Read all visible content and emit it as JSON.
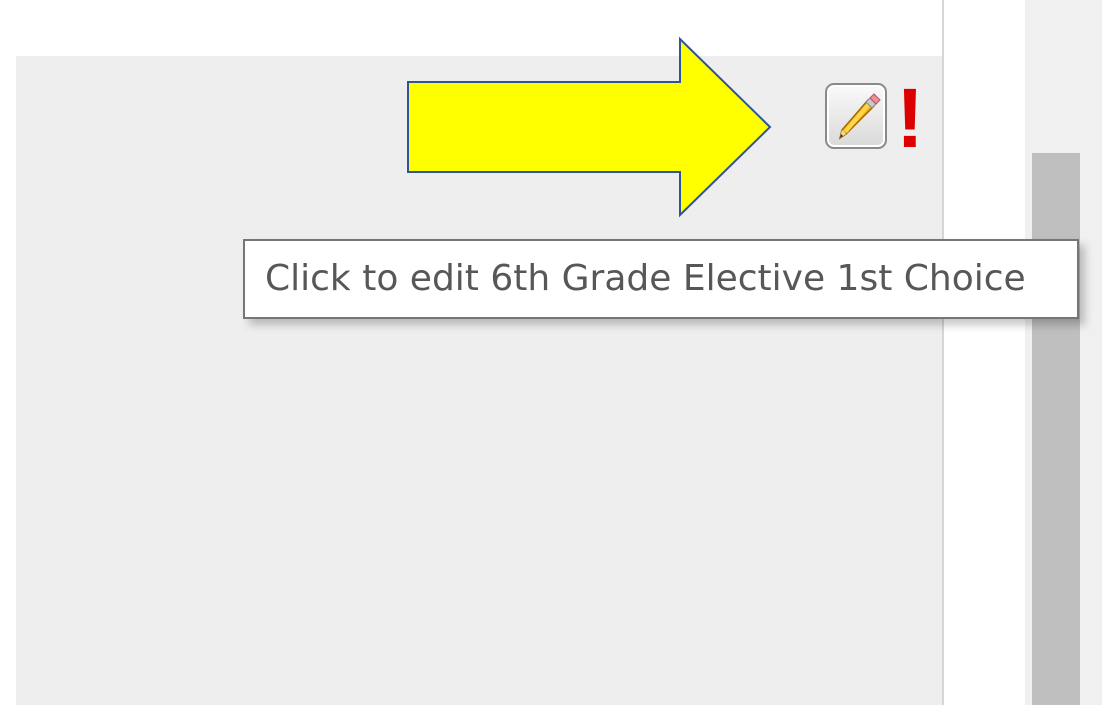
{
  "tooltip": {
    "text": "Click to edit 6th Grade Elective 1st Choice"
  },
  "indicator": {
    "required_mark": "!"
  },
  "icons": {
    "edit": "pencil-icon",
    "annotation": "arrow-right-icon"
  },
  "colors": {
    "arrow_fill": "#ffff00",
    "arrow_stroke": "#2f5597",
    "required_mark": "#dd0000",
    "panel_background": "#eeeeee",
    "scroll_thumb": "#bfbfbf"
  }
}
